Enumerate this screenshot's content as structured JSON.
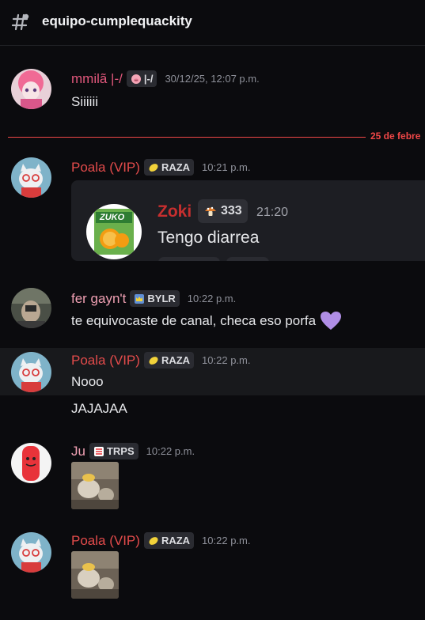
{
  "channel": {
    "name": "equipo-cumplequackity"
  },
  "divider": {
    "label": "25 de febre"
  },
  "messages": [
    {
      "username": "mmilã |-/",
      "username_color": "#e0577b",
      "tag": "|-/",
      "tag_icon": "pig-emoji-icon",
      "timestamp": "30/12/25, 12:07 p.m.",
      "content": "Siiiiii"
    },
    {
      "username": "Poala (VIP)",
      "username_color": "#e34b4b",
      "tag": "RAZA",
      "tag_icon": "lemon-icon",
      "timestamp": "10:21 p.m.",
      "embed": {
        "username": "Zoki",
        "tag": "333",
        "tag_icon": "mushroom-icon",
        "timestamp": "21:20",
        "content": "Tengo diarrea",
        "image_label": "ZUKO"
      }
    },
    {
      "username": "fer gayn't",
      "username_color": "#f0a0b3",
      "tag": "BYLR",
      "tag_icon": "crown-icon",
      "timestamp": "10:22 p.m.",
      "content": "te equivocaste de canal, checa eso porfa",
      "emoji": "purple-heart-icon"
    },
    {
      "username": "Poala (VIP)",
      "username_color": "#e34b4b",
      "tag": "RAZA",
      "tag_icon": "lemon-icon",
      "timestamp": "10:22 p.m.",
      "content": "Nooo",
      "followup": "JAJAJAA"
    },
    {
      "username": "Ju",
      "username_color": "#f0a0b3",
      "tag": "TRPS",
      "tag_icon": "candy-icon",
      "timestamp": "10:22 p.m.",
      "attachment": "image-thumbnail"
    },
    {
      "username": "Poala (VIP)",
      "username_color": "#e34b4b",
      "tag": "RAZA",
      "tag_icon": "lemon-icon",
      "timestamp": "10:22 p.m.",
      "attachment": "image-thumbnail"
    }
  ]
}
